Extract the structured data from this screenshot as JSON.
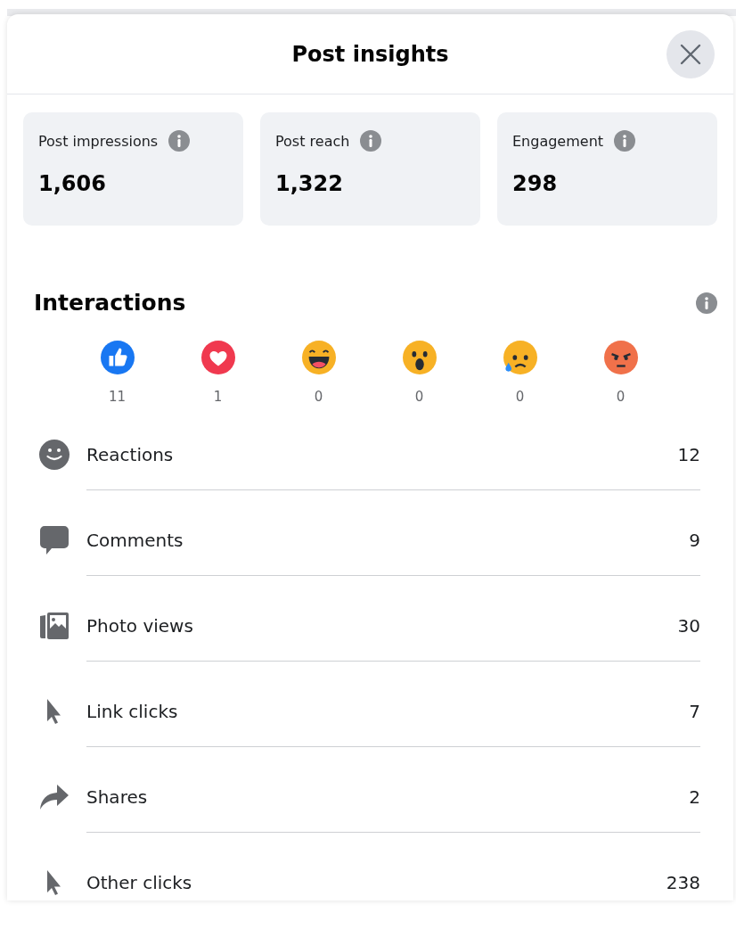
{
  "dialog": {
    "title": "Post insights"
  },
  "summary_cards": [
    {
      "label": "Post impressions",
      "value": "1,606"
    },
    {
      "label": "Post reach",
      "value": "1,322"
    },
    {
      "label": "Engagement",
      "value": "298"
    }
  ],
  "interactions": {
    "title": "Interactions",
    "reactions": [
      {
        "kind": "like",
        "count": "11"
      },
      {
        "kind": "love",
        "count": "1"
      },
      {
        "kind": "haha",
        "count": "0"
      },
      {
        "kind": "wow",
        "count": "0"
      },
      {
        "kind": "sad",
        "count": "0"
      },
      {
        "kind": "angry",
        "count": "0"
      }
    ],
    "metrics": [
      {
        "kind": "smiley",
        "label": "Reactions",
        "value": "12"
      },
      {
        "kind": "comment",
        "label": "Comments",
        "value": "9"
      },
      {
        "kind": "photo",
        "label": "Photo views",
        "value": "30"
      },
      {
        "kind": "cursor",
        "label": "Link clicks",
        "value": "7"
      },
      {
        "kind": "share",
        "label": "Shares",
        "value": "2"
      },
      {
        "kind": "cursor",
        "label": "Other clicks",
        "value": "238"
      }
    ]
  }
}
